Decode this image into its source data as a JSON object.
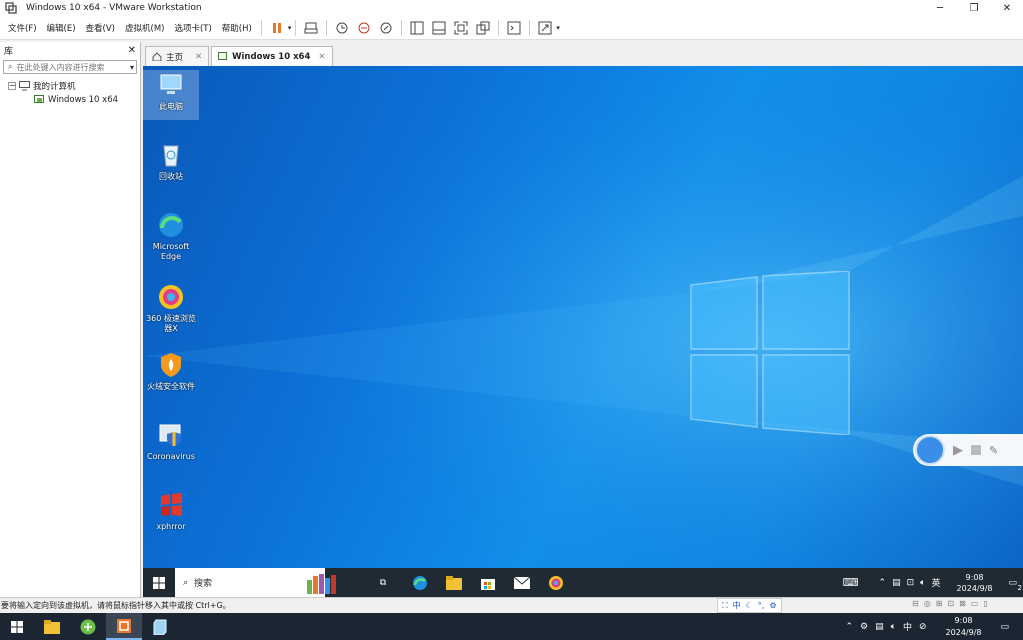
{
  "window": {
    "title": "Windows 10 x64 - VMware Workstation"
  },
  "menu": [
    "文件(F)",
    "编辑(E)",
    "查看(V)",
    "虚拟机(M)",
    "选项卡(T)",
    "帮助(H)"
  ],
  "library": {
    "title": "库",
    "search_placeholder": "在此处键入内容进行搜索",
    "root": "我的计算机",
    "vm": "Windows 10 x64"
  },
  "tabs": {
    "home": "主页",
    "vm": "Windows 10 x64"
  },
  "desktop": {
    "icons": [
      {
        "label": "此电脑"
      },
      {
        "label": "回收站"
      },
      {
        "label": "Microsoft Edge"
      },
      {
        "label": "360 极速浏览器X"
      },
      {
        "label": "火绒安全软件"
      },
      {
        "label": "Coronavirus"
      },
      {
        "label": "xphrror"
      }
    ]
  },
  "guest_taskbar": {
    "search": "搜索",
    "ime": "英",
    "time": "9:08",
    "date": "2024/9/8",
    "notif_count": "2"
  },
  "statusbar": {
    "message": "要将输入定向到该虚拟机，请将鼠标指针移入其中或按 Ctrl+G。",
    "ime_zh": "中"
  },
  "host_taskbar": {
    "ime": "中",
    "time": "9:08",
    "date": "2024/9/8"
  },
  "colors": {
    "desktop": "#0c72d9",
    "taskbar": "#1f2a33",
    "accent_orange": "#e8772e"
  }
}
